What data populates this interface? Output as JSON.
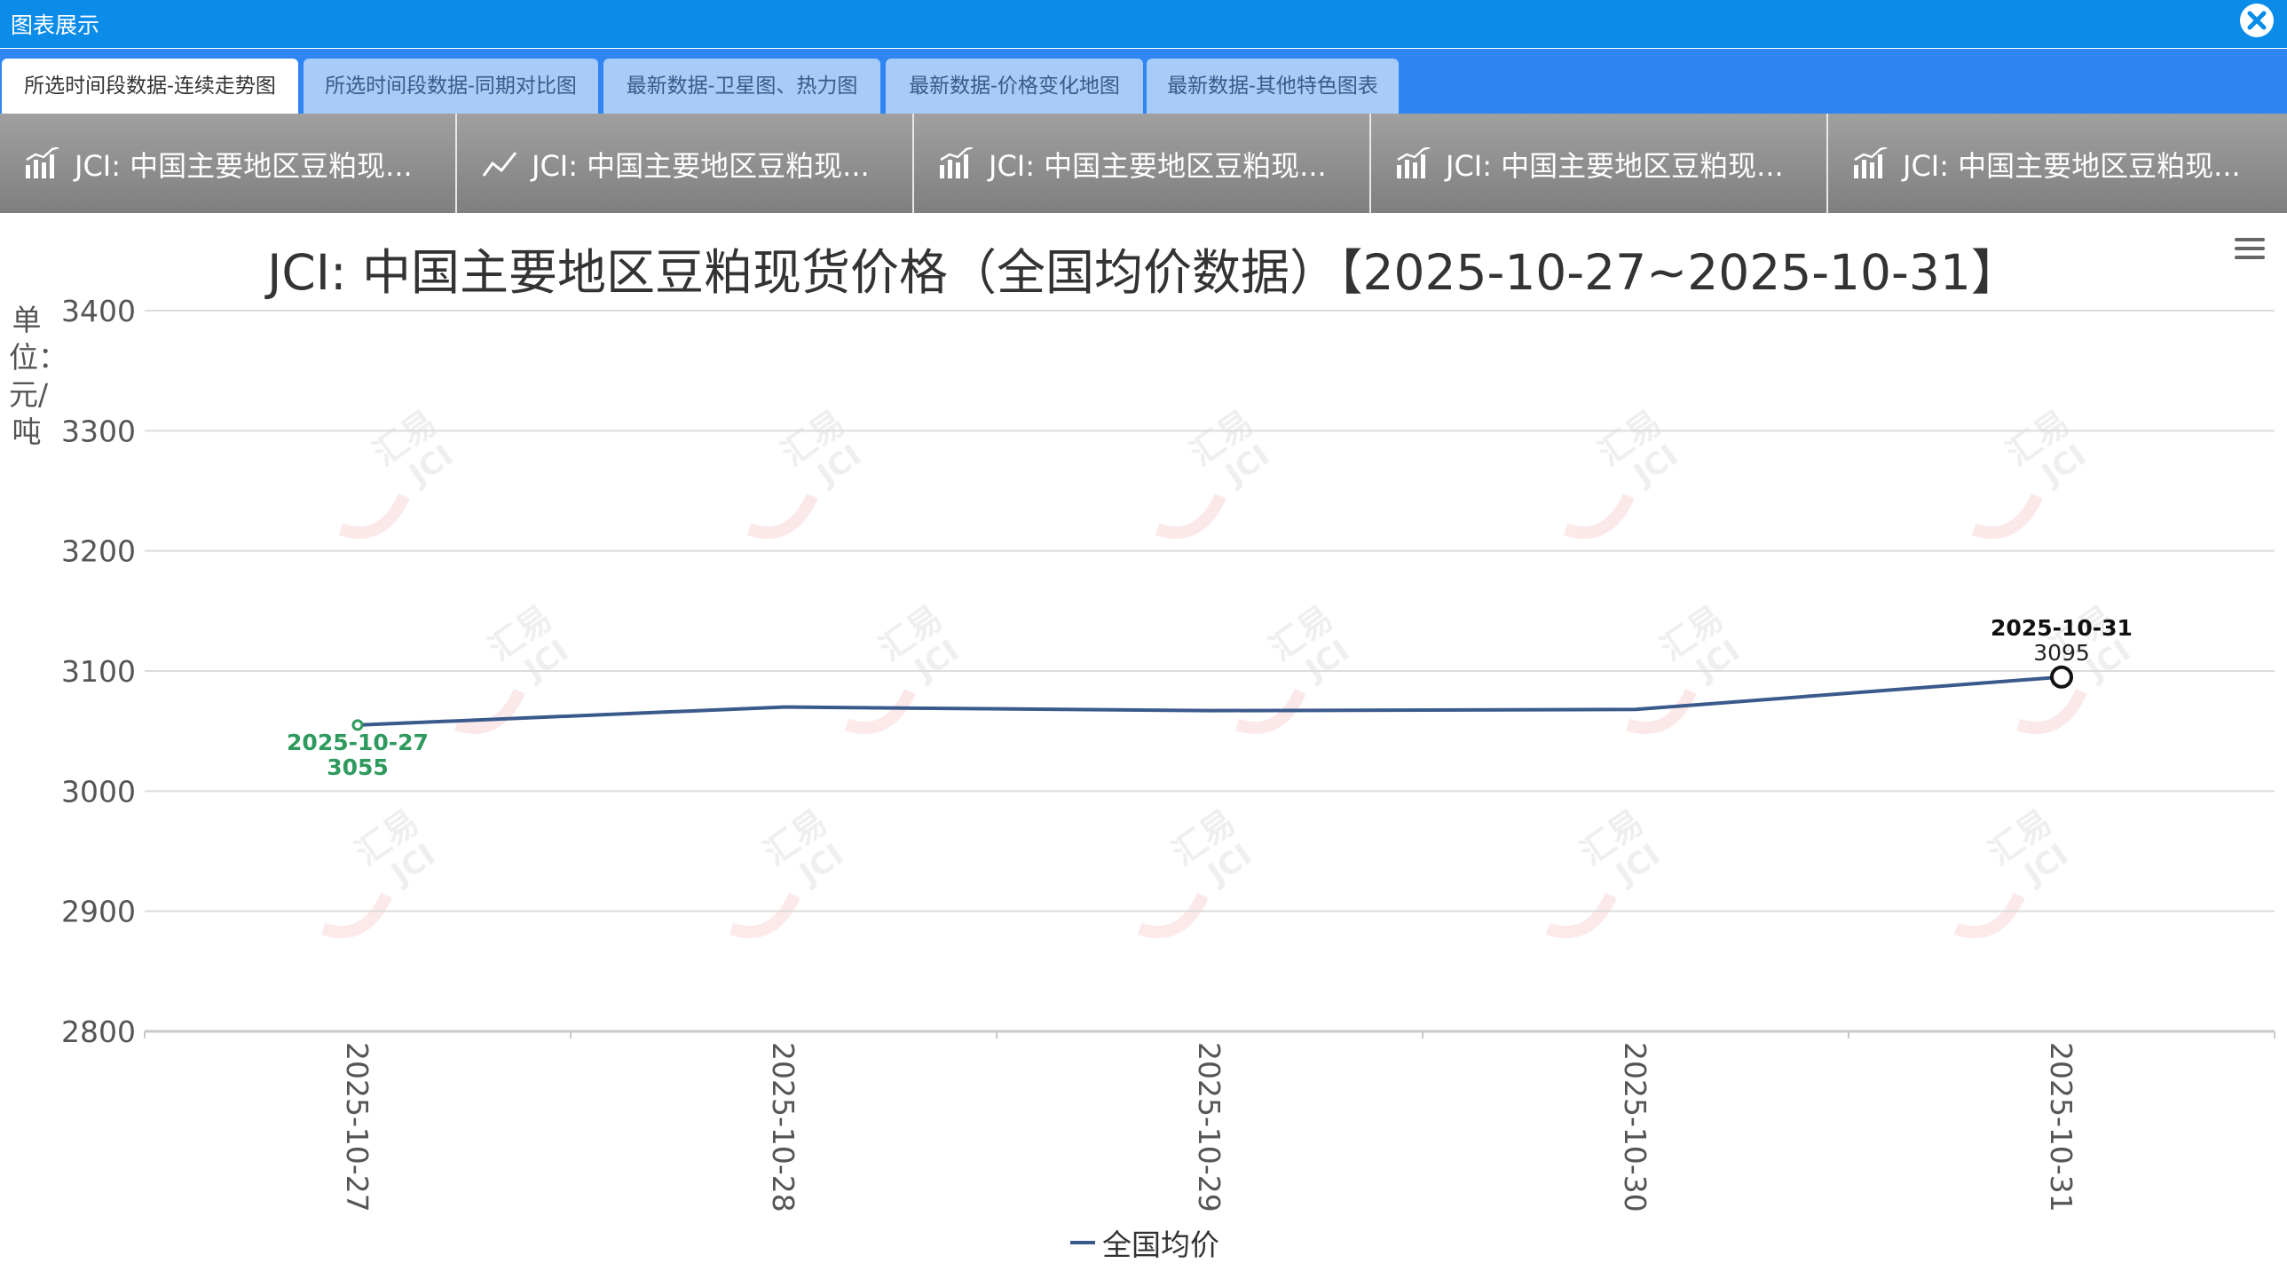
{
  "window": {
    "title": "图表展示",
    "close_icon": "close-icon"
  },
  "tabs": [
    {
      "label": "所选时间段数据-连续走势图",
      "active": true
    },
    {
      "label": "所选时间段数据-同期对比图",
      "active": false
    },
    {
      "label": "最新数据-卫星图、热力图",
      "active": false
    },
    {
      "label": "最新数据-价格变化地图",
      "active": false
    },
    {
      "label": "最新数据-其他特色图表",
      "active": false
    }
  ],
  "subtabs": [
    {
      "label": "JCI: 中国主要地区豆粕现...",
      "icon": "bar-chart-icon"
    },
    {
      "label": "JCI: 中国主要地区豆粕现...",
      "icon": "line-chart-icon"
    },
    {
      "label": "JCI: 中国主要地区豆粕现...",
      "icon": "bar-chart-icon"
    },
    {
      "label": "JCI: 中国主要地区豆粕现...",
      "icon": "bar-chart-icon"
    },
    {
      "label": "JCI: 中国主要地区豆粕现...",
      "icon": "bar-chart-icon"
    }
  ],
  "colors": {
    "titlebar": "#0b8ce9",
    "tabbar": "#2f86f2",
    "series": "#3a5a8c",
    "start_label": "#2e9a5e",
    "end_label": "#111111",
    "watermark": "#e8545a"
  },
  "watermark": {
    "text_cn": "汇易",
    "text_en": "JCI"
  },
  "menu_icon": "hamburger-menu-icon",
  "chart_data": {
    "type": "line",
    "title": "JCI: 中国主要地区豆粕现货价格（全国均价数据）【2025-10-27~2025-10-31】",
    "ylabel": "单位：元/吨",
    "xlabel": "",
    "categories": [
      "2025-10-27",
      "2025-10-28",
      "2025-10-29",
      "2025-10-30",
      "2025-10-31"
    ],
    "series": [
      {
        "name": "全国均价",
        "values": [
          3055,
          3070,
          3067,
          3068,
          3095
        ]
      }
    ],
    "ylim": [
      2800,
      3400
    ],
    "yticks": [
      3400,
      3300,
      3200,
      3100,
      3000,
      2900,
      2800
    ],
    "grid": true,
    "legend": "bottom-center",
    "annotations": [
      {
        "x": "2025-10-27",
        "y": 3055,
        "date_text": "2025-10-27",
        "value_text": "3055"
      },
      {
        "x": "2025-10-31",
        "y": 3095,
        "date_text": "2025-10-31",
        "value_text": "3095"
      }
    ]
  }
}
